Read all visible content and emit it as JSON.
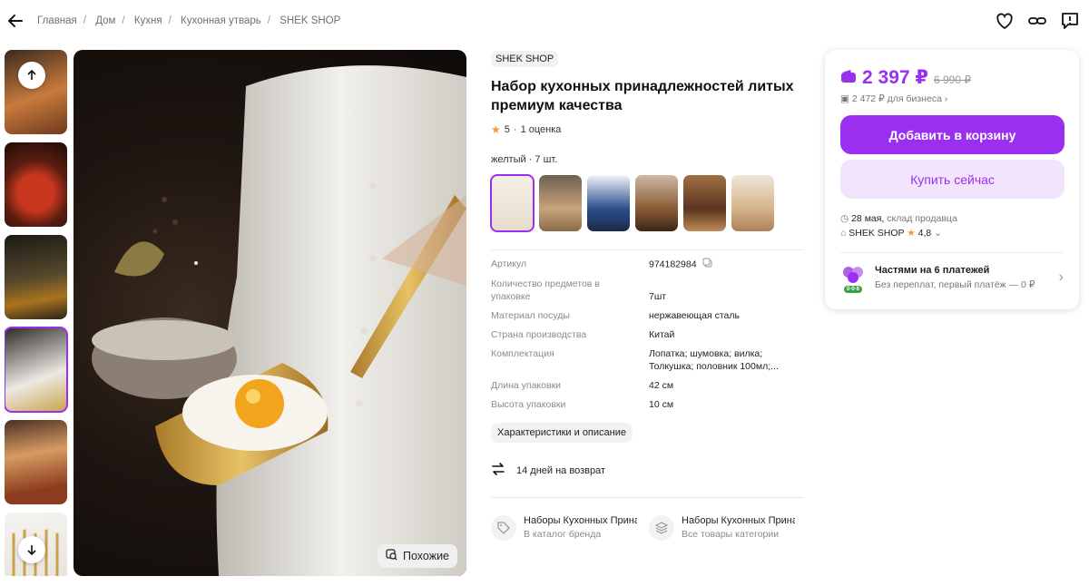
{
  "breadcrumbs": [
    "Главная",
    "Дом",
    "Кухня",
    "Кухонная утварь",
    "SHEK SHOP"
  ],
  "gallery": {
    "similar_label": "Похожие",
    "thumb_icons": [
      "arrow-up-icon",
      "arrow-down-icon"
    ]
  },
  "product": {
    "brand": "SHEK SHOP",
    "title": "Набор кухонных принадлежностей литых премиум качества",
    "rating": "5",
    "reviews": "1 оценка",
    "variant": "желтый · 7 шт.",
    "specs": [
      {
        "k": "Артикул",
        "v": "974182984"
      },
      {
        "k": "Количество предметов в упаковке",
        "v": "7шт"
      },
      {
        "k": "Материал посуды",
        "v": "нержавеющая сталь"
      },
      {
        "k": "Страна производства",
        "v": "Китай"
      },
      {
        "k": "Комплектация",
        "v": "Лопатка; шумовка; вилка; Толкушка; половник 100мл;..."
      },
      {
        "k": "Длина упаковки",
        "v": "42 см"
      },
      {
        "k": "Высота упаковки",
        "v": "10 см"
      }
    ],
    "more_label": "Характеристики и описание",
    "return_label": "14 дней на возврат",
    "links": [
      {
        "title": "Наборы Кухонных Принадлежностей",
        "sub": "В каталог бренда"
      },
      {
        "title": "Наборы Кухонных Принадлежностей",
        "sub": "Все товары категории"
      }
    ]
  },
  "buy": {
    "price": "2 397 ₽",
    "old_price": "6 990 ₽",
    "business_price": "2 472 ₽ для бизнеса",
    "cart_label": "Добавить в корзину",
    "buy_now_label": "Купить сейчас",
    "delivery_date": "28 мая,",
    "delivery_source": "склад продавца",
    "seller": "SHEK SHOP",
    "seller_rating": "4,8",
    "installment_title": "Частями на 6 платежей",
    "installment_sub": "Без переплат, первый платёж — 0 ₽",
    "installment_badge": "0·0·6"
  },
  "colors": {
    "accent": "#9b2ff0",
    "accent_light": "#f3e4fd",
    "star": "#f29a2e"
  }
}
